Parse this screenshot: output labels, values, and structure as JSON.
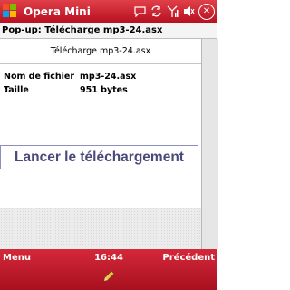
{
  "titlebar": {
    "app_name": "Opera Mini",
    "tray_icons": [
      "chat-icon",
      "sync-icon",
      "signal-icon",
      "volume-icon",
      "close-icon"
    ]
  },
  "popup_header": {
    "text": "Pop-up: Télécharge mp3-24.asx"
  },
  "page": {
    "title": "Télécharge mp3-24.asx",
    "file_label": "Nom de fichier :",
    "file_value": "mp3-24.asx",
    "size_label": "Taille",
    "size_value": "951 bytes",
    "download_button": "Lancer le téléchargement"
  },
  "bottombar": {
    "left_softkey": "Menu",
    "time": "16:44",
    "right_softkey": "Précédent"
  },
  "colors": {
    "titlebar": "#c21a2a",
    "button_text": "#4a4a7a",
    "button_border": "#8b8fbf"
  }
}
